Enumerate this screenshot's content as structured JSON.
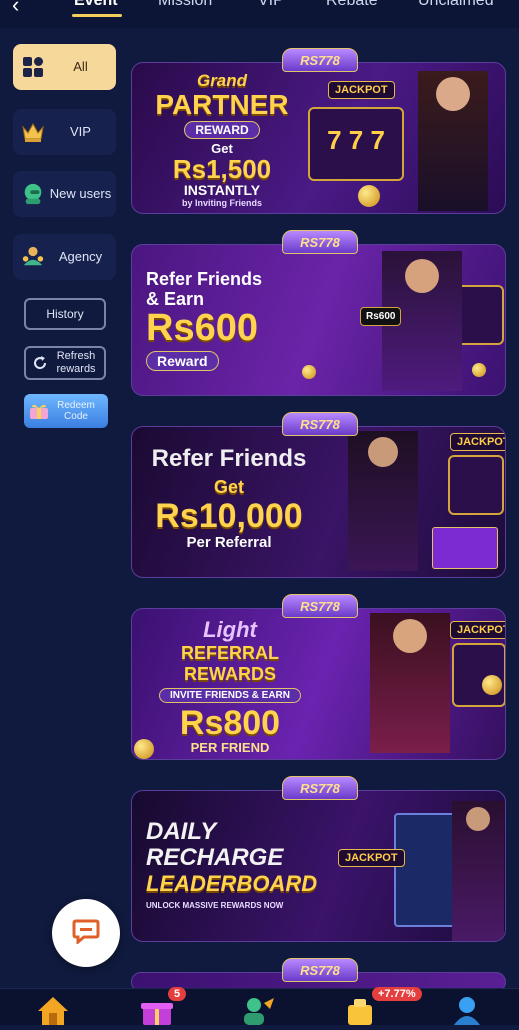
{
  "tabs": [
    {
      "label": "Event"
    },
    {
      "label": "Mission"
    },
    {
      "label": "VIP"
    },
    {
      "label": "Rebate"
    },
    {
      "label": "Unclaimed"
    }
  ],
  "sidebar": {
    "categories": [
      {
        "label": "All"
      },
      {
        "label": "VIP"
      },
      {
        "label": "New users"
      },
      {
        "label": "Agency"
      }
    ],
    "history_label": "History",
    "refresh_label": "Refresh rewards",
    "redeem_label": "Redeem Code"
  },
  "banners": [
    {
      "ribbon": "RS778",
      "line1": "Grand",
      "line2": "PARTNER",
      "pill": "REWARD",
      "line3": "Get",
      "amount": "Rs1,500",
      "line4": "INSTANTLY",
      "line5": "by Inviting Friends",
      "jackpot": "JACKPOT"
    },
    {
      "ribbon": "RS778",
      "line1": "Refer Friends",
      "line2": "& Earn",
      "amount": "Rs600",
      "pill": "Reward",
      "card": "Rs600"
    },
    {
      "ribbon": "RS778",
      "line1": "Refer Friends",
      "line2": "Get",
      "amount": "Rs10,000",
      "line3": "Per Referral",
      "jackpot": "JACKPOT"
    },
    {
      "ribbon": "RS778",
      "line1": "Light",
      "line2": "REFERRAL REWARDS",
      "pill": "INVITE FRIENDS & EARN",
      "amount": "Rs800",
      "line3": "PER FRIEND",
      "jackpot": "JACKPOT"
    },
    {
      "ribbon": "RS778",
      "line1": "DAILY",
      "line2": "RECHARGE",
      "line3": "LEADERBOARD",
      "line4": "UNLOCK MASSIVE REWARDS NOW",
      "jackpot": "JACKPOT"
    },
    {
      "ribbon": "RS778"
    }
  ],
  "bottom_nav": {
    "gift_badge": "5",
    "rebate_badge": "+7.77%"
  },
  "colors": {
    "background": "#101a3e",
    "accent_gold": "#f5d89a",
    "banner_purple": "#3a1670"
  }
}
